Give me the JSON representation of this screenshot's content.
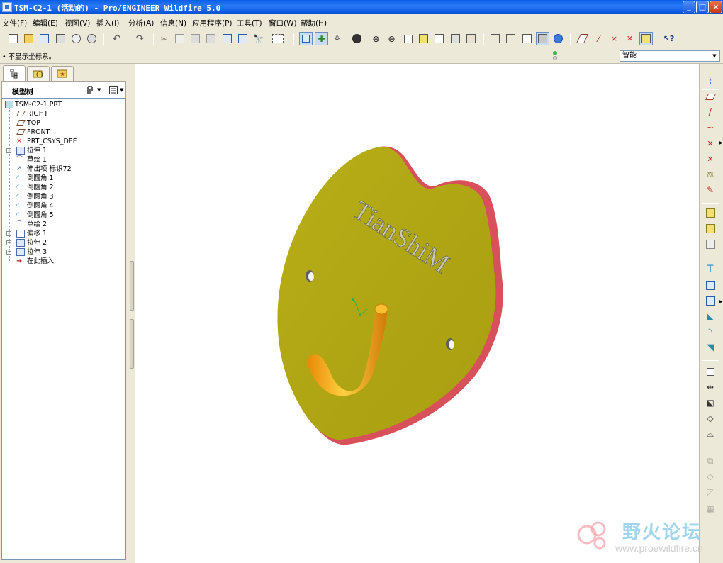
{
  "window": {
    "title": "TSM-C2-1 (活动的) - Pro/ENGINEER Wildfire 5.0",
    "controls": {
      "minimize": "_",
      "maximize": "□",
      "close": "×"
    }
  },
  "menubar": {
    "items": [
      {
        "label": "文件(F)"
      },
      {
        "label": "编辑(E)"
      },
      {
        "label": "视图(V)"
      },
      {
        "label": "插入(I)"
      },
      {
        "label": "分析(A)"
      },
      {
        "label": "信息(N)"
      },
      {
        "label": "应用程序(P)"
      },
      {
        "label": "工具(T)"
      },
      {
        "label": "窗口(W)"
      },
      {
        "label": "帮助(H)"
      }
    ]
  },
  "toolbar": {
    "buttons": [
      {
        "icon": "new-icon"
      },
      {
        "icon": "open-icon"
      },
      {
        "icon": "save-icon"
      },
      {
        "icon": "print-icon"
      },
      {
        "icon": "email-icon"
      },
      {
        "icon": "email-link-icon"
      },
      {
        "icon": "undo-icon"
      },
      {
        "icon": "redo-icon"
      },
      {
        "icon": "cut-icon"
      },
      {
        "icon": "copy-icon"
      },
      {
        "icon": "paste-icon"
      },
      {
        "icon": "paste-special-icon"
      },
      {
        "icon": "regenerate-icon"
      },
      {
        "icon": "regen-manager-icon"
      },
      {
        "icon": "find-icon"
      },
      {
        "icon": "select-box-icon"
      },
      {
        "icon": "datum-display-icon"
      },
      {
        "icon": "spin-center-icon"
      },
      {
        "icon": "orient-icon"
      },
      {
        "icon": "appearance-icon"
      },
      {
        "icon": "zoom-in-icon"
      },
      {
        "icon": "zoom-out-icon"
      },
      {
        "icon": "refit-icon"
      },
      {
        "icon": "reorient-icon"
      },
      {
        "icon": "saved-views-icon"
      },
      {
        "icon": "layers-icon"
      },
      {
        "icon": "view-manager-icon"
      },
      {
        "icon": "wireframe-icon"
      },
      {
        "icon": "hidden-line-icon"
      },
      {
        "icon": "no-hidden-icon"
      },
      {
        "icon": "shading-icon"
      },
      {
        "icon": "enhanced-realism-icon"
      },
      {
        "icon": "datum-planes-icon"
      },
      {
        "icon": "datum-axes-icon"
      },
      {
        "icon": "datum-points-icon"
      },
      {
        "icon": "csys-icon"
      },
      {
        "icon": "annotations-icon"
      },
      {
        "icon": "context-help-icon"
      }
    ]
  },
  "status": {
    "message": "• 不显示坐标系。",
    "filter_label": "智能",
    "light_colors": {
      "top": "#44b844",
      "bottom": "#d0d0d0"
    }
  },
  "navigator": {
    "tabs": [
      {
        "icon": "model-tree-tab-icon"
      },
      {
        "icon": "folder-browser-tab-icon"
      },
      {
        "icon": "favorites-tab-icon"
      }
    ],
    "tree_title": "模型树",
    "tree_settings": "settings-icon",
    "tree_show": "show-icon",
    "items": [
      {
        "label": "TSM-C2-1.PRT",
        "icon": "part-icon",
        "expander": "",
        "root": true
      },
      {
        "label": "RIGHT",
        "icon": "datum-plane-icon",
        "expander": ""
      },
      {
        "label": "TOP",
        "icon": "datum-plane-icon",
        "expander": ""
      },
      {
        "label": "FRONT",
        "icon": "datum-plane-icon",
        "expander": ""
      },
      {
        "label": "PRT_CSYS_DEF",
        "icon": "csys-icon",
        "expander": ""
      },
      {
        "label": "拉伸 1",
        "icon": "extrude-icon",
        "expander": "+"
      },
      {
        "label": "草绘 1",
        "icon": "sketch-icon",
        "expander": ""
      },
      {
        "label": "伸出项 标识72",
        "icon": "protrusion-icon",
        "expander": ""
      },
      {
        "label": "倒圆角 1",
        "icon": "round-icon",
        "expander": ""
      },
      {
        "label": "倒圆角 2",
        "icon": "round-icon",
        "expander": ""
      },
      {
        "label": "倒圆角 3",
        "icon": "round-icon",
        "expander": ""
      },
      {
        "label": "倒圆角 4",
        "icon": "round-icon",
        "expander": ""
      },
      {
        "label": "倒圆角 5",
        "icon": "round-icon",
        "expander": ""
      },
      {
        "label": "草绘 2",
        "icon": "sketch-icon",
        "expander": ""
      },
      {
        "label": "偏移 1",
        "icon": "offset-icon",
        "expander": "+"
      },
      {
        "label": "拉伸 2",
        "icon": "extrude-icon",
        "expander": "+"
      },
      {
        "label": "拉伸 3",
        "icon": "extrude-icon",
        "expander": "+"
      },
      {
        "label": "在此插入",
        "icon": "insert-here-icon",
        "expander": ""
      }
    ]
  },
  "graphics": {
    "embossed_text": "TianShiM",
    "plate_color": "#b3aa14",
    "edge_color": "#d8505a",
    "hook_color": "#f2a818"
  },
  "right_toolbar": {
    "buttons": [
      {
        "icon": "datum-display-filter-icon"
      },
      {
        "icon": "datum-plane-tool-icon"
      },
      {
        "icon": "datum-axis-tool-icon"
      },
      {
        "icon": "datum-curve-tool-icon"
      },
      {
        "icon": "datum-point-tool-icon"
      },
      {
        "icon": "datum-csys-tool-icon"
      },
      {
        "icon": "analysis-feature-icon"
      },
      {
        "icon": "sketch-tool-icon"
      },
      {
        "icon": "extrude-tool-icon"
      },
      {
        "icon": "revolve-tool-icon"
      },
      {
        "icon": "variable-sweep-icon"
      },
      {
        "icon": "boundary-blend-icon"
      },
      {
        "icon": "hole-tool-icon"
      },
      {
        "icon": "shell-tool-icon"
      },
      {
        "icon": "rib-tool-icon"
      },
      {
        "icon": "draft-tool-icon"
      },
      {
        "icon": "round-tool-icon"
      },
      {
        "icon": "chamfer-tool-icon"
      },
      {
        "icon": "pattern-tool-icon"
      },
      {
        "icon": "mirror-tool-icon"
      },
      {
        "icon": "merge-tool-icon"
      },
      {
        "icon": "trim-tool-icon"
      },
      {
        "icon": "extend-tool-icon"
      },
      {
        "icon": "offset-tool-icon"
      },
      {
        "icon": "thicken-tool-icon"
      },
      {
        "icon": "solidify-tool-icon"
      }
    ]
  },
  "watermark": {
    "site_name": "野火论坛",
    "url": "www.proewildfire.cn"
  }
}
